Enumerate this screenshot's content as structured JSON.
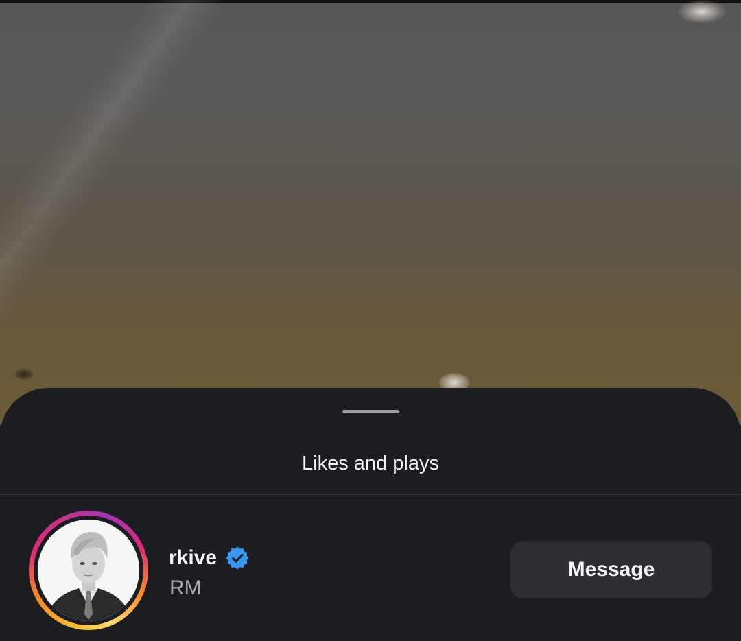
{
  "sheet": {
    "title": "Likes and plays"
  },
  "account": {
    "username": "rkive",
    "full_name": "RM",
    "verified": true,
    "story_ring": true
  },
  "actions": {
    "message_label": "Message"
  },
  "colors": {
    "sheet_background": "#1c1d21",
    "verified_badge": "#3897f0",
    "button_background": "#2c2e33"
  },
  "icons": {
    "verified": "verified-badge-icon",
    "handle": "drag-handle"
  }
}
